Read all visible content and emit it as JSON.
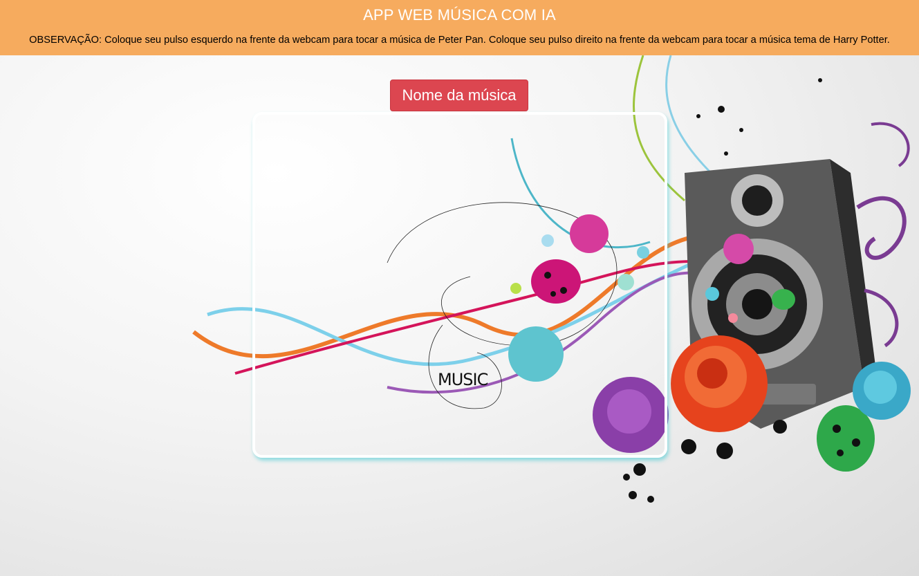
{
  "header": {
    "title": "APP WEB MÚSICA COM IA",
    "note": "OBSERVAÇÃO: Coloque seu pulso esquerdo na frente da webcam para tocar a música de Peter Pan. Coloque seu pulso direito na frente da webcam para tocar a música tema de Harry Potter."
  },
  "main": {
    "song_button_label": "Nome da música",
    "background_word": "MUSIC"
  },
  "colors": {
    "header_bg": "#f6ab5e",
    "button_bg": "#dc4650",
    "frame_shadow": "#3cc8d2"
  },
  "icons": [
    "speaker-icon",
    "rose-icon",
    "ladybug-icon"
  ]
}
